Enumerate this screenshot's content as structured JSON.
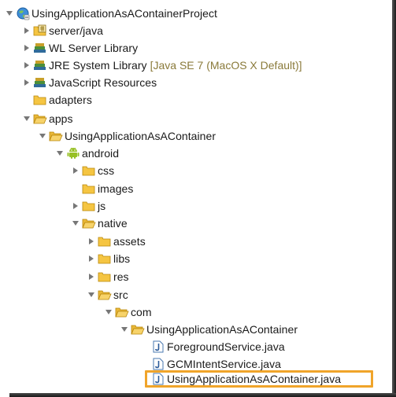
{
  "tree": {
    "project": {
      "label": "UsingApplicationAsAContainerProject",
      "icon": "project-globe-icon"
    },
    "server_java": {
      "label": "server/java",
      "icon": "source-folder-icon"
    },
    "wl_server_library": {
      "label": "WL Server Library",
      "icon": "library-icon"
    },
    "jre_system_library": {
      "label": "JRE System Library",
      "decoration": "[Java SE 7 (MacOS X Default)]",
      "icon": "library-icon"
    },
    "javascript_resources": {
      "label": "JavaScript Resources",
      "icon": "library-icon"
    },
    "adapters": {
      "label": "adapters",
      "icon": "folder-icon"
    },
    "apps": {
      "label": "apps",
      "icon": "folder-open-icon"
    },
    "app": {
      "label": "UsingApplicationAsAContainer",
      "icon": "folder-open-icon"
    },
    "android": {
      "label": "android",
      "icon": "android-icon"
    },
    "css": {
      "label": "css",
      "icon": "folder-icon"
    },
    "images": {
      "label": "images",
      "icon": "folder-icon"
    },
    "js": {
      "label": "js",
      "icon": "folder-icon"
    },
    "native": {
      "label": "native",
      "icon": "folder-open-icon"
    },
    "assets": {
      "label": "assets",
      "icon": "folder-icon"
    },
    "libs": {
      "label": "libs",
      "icon": "folder-icon"
    },
    "res": {
      "label": "res",
      "icon": "folder-icon"
    },
    "src": {
      "label": "src",
      "icon": "folder-open-icon"
    },
    "com": {
      "label": "com",
      "icon": "folder-open-icon"
    },
    "pkg": {
      "label": "UsingApplicationAsAContainer",
      "icon": "folder-open-icon"
    },
    "files": [
      {
        "label": "ForegroundService.java",
        "icon": "java-file-icon"
      },
      {
        "label": "GCMIntentService.java",
        "icon": "java-file-icon"
      },
      {
        "label": "UsingApplicationAsAContainer.java",
        "icon": "java-file-icon"
      }
    ]
  },
  "colors": {
    "selection_border": "#f0a42a",
    "folder": "#f5c542",
    "library_book": "#2f6b9a",
    "android": "#97c024",
    "decoration_text": "#8a7a3a"
  }
}
